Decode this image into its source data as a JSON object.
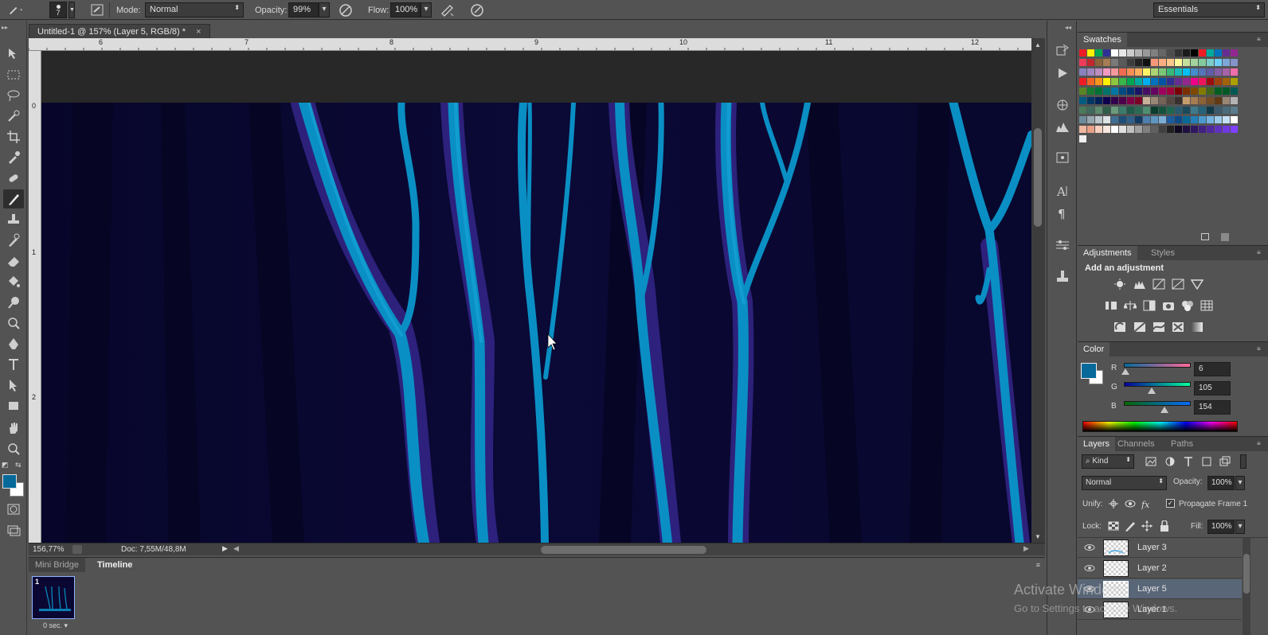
{
  "options_bar": {
    "brush_size": "7",
    "mode_label": "Mode:",
    "mode_value": "Normal",
    "opacity_label": "Opacity:",
    "opacity_value": "99%",
    "flow_label": "Flow:",
    "flow_value": "100%",
    "workspace": "Essentials"
  },
  "document": {
    "tab_title": "Untitled-1 @ 157% (Layer 5, RGB/8) *",
    "close_glyph": "×",
    "ruler_top_labels": [
      "6",
      "7",
      "8",
      "9",
      "10",
      "11",
      "12"
    ],
    "ruler_left_labels": [
      "0",
      "1",
      "2"
    ],
    "zoom": "156,77%",
    "doc_size": "Doc: 7,55M/48,8M"
  },
  "timeline": {
    "tabs": [
      "Mini Bridge",
      "Timeline"
    ],
    "frame_number": "1",
    "frame_delay": "0 sec."
  },
  "swatches": {
    "title": "Swatches",
    "colors": [
      "#ec1c24",
      "#fff200",
      "#00a651",
      "#2e3192",
      "#ffffff",
      "#e6e6e6",
      "#cccccc",
      "#b3b3b3",
      "#999999",
      "#808080",
      "#666666",
      "#4d4d4d",
      "#333333",
      "#1a1a1a",
      "#000000",
      "#ed1c24",
      "#00a99d",
      "#0072bc",
      "#662d91",
      "#92278f",
      "#ee3b5a",
      "#c1272d",
      "#8c6239",
      "#a67c52",
      "#7a7a7a",
      "#5a5a5a",
      "#3d3d3d",
      "#222222",
      "#111111",
      "#f7977a",
      "#f9ad81",
      "#fdc68a",
      "#fff79a",
      "#c4df9b",
      "#a3d39c",
      "#82ca9d",
      "#7bcdc8",
      "#6ecff6",
      "#7ea7d8",
      "#8493ca",
      "#8882be",
      "#a187be",
      "#bc8dbf",
      "#f49ac2",
      "#f6989d",
      "#f26c4f",
      "#f68e56",
      "#fbaf5d",
      "#fff467",
      "#acd373",
      "#7cc576",
      "#3bb878",
      "#1abbb4",
      "#00bff3",
      "#438ccb",
      "#5574b9",
      "#605ca8",
      "#855fa8",
      "#a763a8",
      "#f06eaa",
      "#ed1c24",
      "#f26522",
      "#f7941d",
      "#fff200",
      "#8dc73f",
      "#39b54a",
      "#00a651",
      "#00a99d",
      "#00aeef",
      "#0072bc",
      "#0054a6",
      "#2e3192",
      "#662d91",
      "#92278f",
      "#ec008c",
      "#ed145b",
      "#9e0b0f",
      "#a0410d",
      "#a36209",
      "#aba000",
      "#598527",
      "#1a7b30",
      "#007236",
      "#00746b",
      "#0076a3",
      "#004b80",
      "#003471",
      "#1b1464",
      "#440e62",
      "#630460",
      "#9e005d",
      "#9e0039",
      "#790000",
      "#7b2e00",
      "#7d4900",
      "#827b00",
      "#406618",
      "#005e20",
      "#005826",
      "#005952",
      "#005b7f",
      "#003663",
      "#002157",
      "#0d004c",
      "#32004b",
      "#4b0049",
      "#7b0046",
      "#7a0026",
      "#c7b299",
      "#998675",
      "#736357",
      "#534741",
      "#37302d",
      "#c69c6d",
      "#a67c52",
      "#8c6239",
      "#754c24",
      "#603913",
      "#998675",
      "#b3b3b3",
      "#4a7a5a",
      "#3e6b5e",
      "#5c8a6e",
      "#2f5e4a",
      "#6a9b7c",
      "#3a7d6b",
      "#1d5c4a",
      "#2b6b55",
      "#4e8f72",
      "#0b3d2e",
      "#14523e",
      "#1f6650",
      "#285c6e",
      "#1a4a5c",
      "#3e7a8c",
      "#24627a",
      "#0f3a4a",
      "#3c5a6b",
      "#4a6b7c",
      "#5b7c8d",
      "#6e8c9c",
      "#98a8b0",
      "#bac6cc",
      "#dde2e5",
      "#3f6e94",
      "#1d4e7a",
      "#2f5f8a",
      "#103a63",
      "#4a7fae",
      "#5e96c2",
      "#7aaed6",
      "#1a5c9e",
      "#0d4a8a",
      "#06699a",
      "#2580b8",
      "#4a9ad0",
      "#73b4e0",
      "#9ccbec",
      "#c4e0f4",
      "#ffffff",
      "#f0b8a0",
      "#e8a088",
      "#f8d0c0",
      "#f8e8e0",
      "#ffffff",
      "#e0e0e0",
      "#c0c0c0",
      "#a0a0a0",
      "#808080",
      "#606060",
      "#404040",
      "#202020",
      "#100820",
      "#201040",
      "#301860",
      "#402080",
      "#5028a0",
      "#6030c0",
      "#7038e0",
      "#8040ff",
      "#f0f0f0"
    ]
  },
  "adjustments": {
    "tabs": [
      "Adjustments",
      "Styles"
    ],
    "heading": "Add an adjustment"
  },
  "color": {
    "title": "Color",
    "fg": "#06699a",
    "bg": "#ffffff",
    "channels": [
      {
        "label": "R",
        "value": "6",
        "level": 0.024
      },
      {
        "label": "G",
        "value": "105",
        "level": 0.412
      },
      {
        "label": "B",
        "value": "154",
        "level": 0.604
      }
    ]
  },
  "layers": {
    "tabs": [
      "Layers",
      "Channels",
      "Paths"
    ],
    "kind_label": "Kind",
    "blend_mode": "Normal",
    "opacity_label": "Opacity:",
    "opacity_value": "100%",
    "unify_label": "Unify:",
    "propagate_label": "Propagate Frame 1",
    "lock_label": "Lock:",
    "fill_label": "Fill:",
    "fill_value": "100%",
    "items": [
      {
        "name": "Layer 3",
        "selected": false
      },
      {
        "name": "Layer 2",
        "selected": false
      },
      {
        "name": "Layer 5",
        "selected": true
      },
      {
        "name": "Layer 1",
        "selected": false
      }
    ]
  },
  "watermark": {
    "line1": "Activate Windows",
    "line2": "Go to Settings to activate Windows."
  }
}
